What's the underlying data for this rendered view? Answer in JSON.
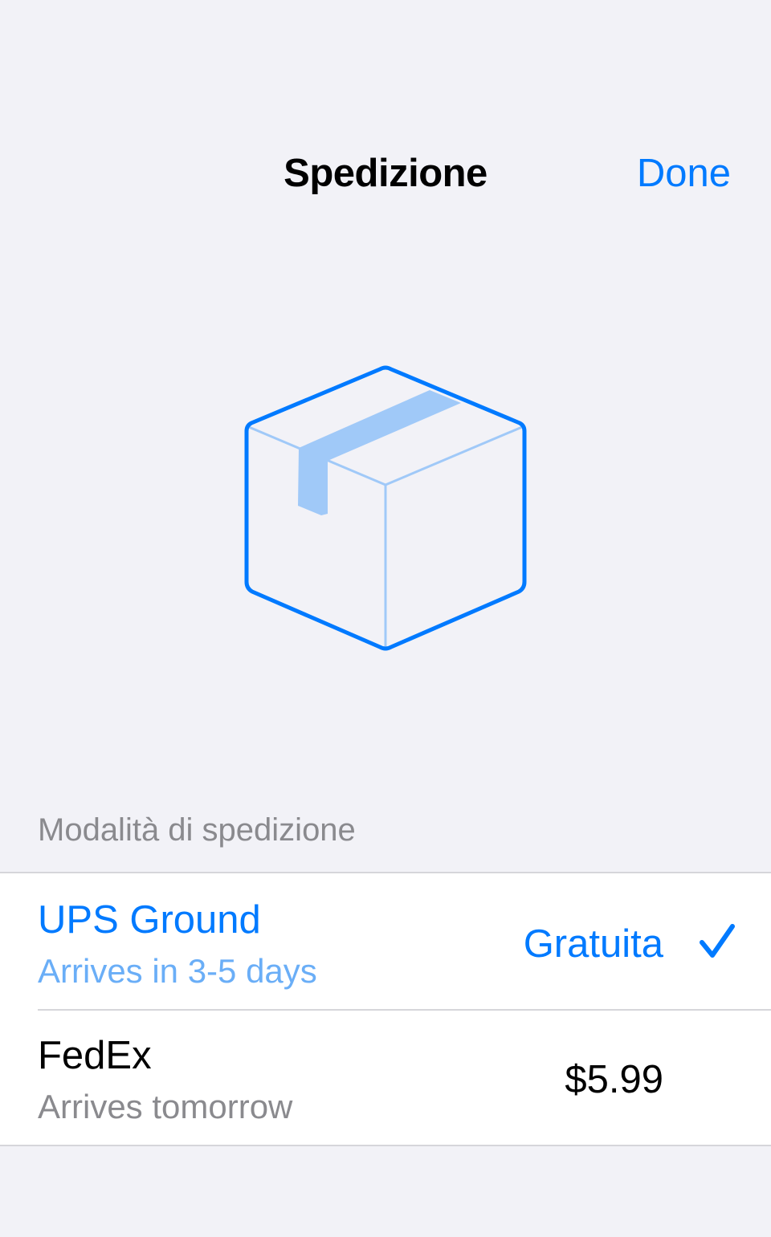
{
  "nav": {
    "title": "Spedizione",
    "done_label": "Done"
  },
  "illustration": {
    "icon": "package-box-icon"
  },
  "shipping": {
    "section_header": "Modalità di spedizione",
    "options": [
      {
        "name": "UPS Ground",
        "subtitle": "Arrives in 3-5 days",
        "price": "Gratuita",
        "selected": true
      },
      {
        "name": "FedEx",
        "subtitle": "Arrives tomorrow",
        "price": "$5.99",
        "selected": false
      }
    ]
  },
  "colors": {
    "accent": "#007aff",
    "accent_light": "#a0c9f8",
    "background": "#f2f2f7",
    "secondary_text": "#8a8a8e"
  }
}
